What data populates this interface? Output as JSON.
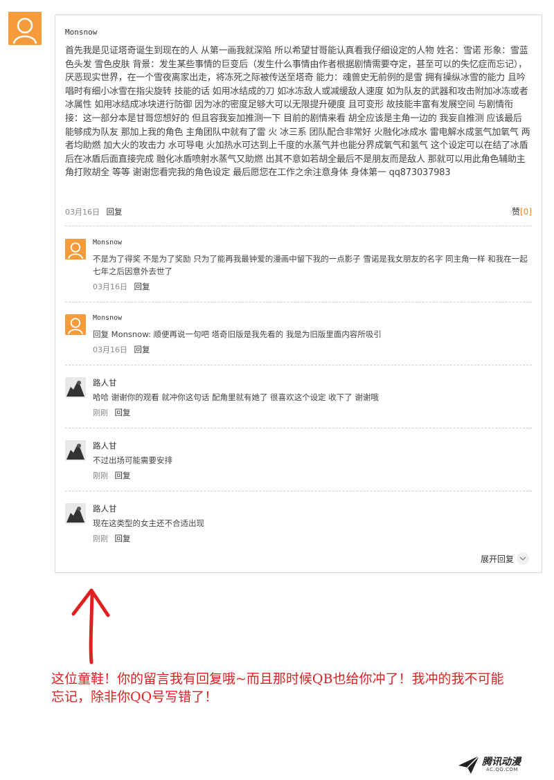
{
  "main_comment": {
    "username": "Monsnow",
    "text": "首先我是见证塔奇诞生到现在的人 从第一画我就深陷 所以希望甘哥能认真看我仔细设定的人物 姓名：雪诺 形象：雪蓝色头发 雪色皮肤 背景：发生某些事情的巨变后（发生什么事情由作者根据剧情需要夺定，甚至可以的失忆症而忘记），厌恶现实世界，在一个雪夜离家出走，将冻死之际被传送至塔奇 能力：魂兽史无前例的是雪 拥有操纵冰雪的能力 且吟唱时有细小冰雪在指尖旋转 技能的话 如用冰结成的刀 如冰冻敌人或减缓敌人速度 如为队友的武器和攻击附加冰冻或者冰属性 如用冰结成冰块进行防御 因为冰的密度足够大可以无限提升硬度 且可变形 故技能丰富有发展空间 与剧情衔接：这一部分本是甘哥您想好的 但且容我妄加推测一下 目前的剧情来看 胡全应该是主角一边的 我妄自推测 应该最后能够成为队友 那加上我的角色 主角团队中就有了雷 火 冰三系 团队配合非常好 火融化冰成水 雷电解水成氢气加氧气 两者均助燃 加大火的攻击力 水可导电 火加热水可达到上千度的水蒸气并也能分界成氧气和氢气 这个设定可以在结了冰盾后在冰盾后面直接完成 融化冰盾喷射水蒸气又助燃 出其不意如若胡全最后不是朋友而是敌人 那就可以用此角色辅助主角打败胡全 等等 谢谢您看完我的角色设定 最后愿您在工作之余注意身体 身体第一 qq873037983",
    "date": "03月16日",
    "reply_label": "回复",
    "like_label": "赞",
    "like_count": "[0]"
  },
  "replies": [
    {
      "username": "Monsnow",
      "text": "不是为了得奖 不是为了奖励 只为了能再我最钟爱的漫画中留下我的一点影子 雪诺是我女朋友的名字 同主角一样 和我在一起七年之后因意外去世了",
      "date": "03月16日",
      "reply_label": "回复"
    },
    {
      "username": "Monsnow",
      "text": "回复 Monsnow: 顺便再说一句吧 塔奇旧版是我先看的 我是为旧版里面内容所吸引",
      "date": "03月16日",
      "reply_label": "回复"
    },
    {
      "username": "路人甘",
      "text": "哈哈 谢谢你的观看 就冲你这句话 配角里就有她了 很喜欢这个设定 收下了 谢谢哦",
      "date": "刚刚",
      "reply_label": "回复"
    },
    {
      "username": "路人甘",
      "text": "不过出场可能需要安排",
      "date": "刚刚",
      "reply_label": "回复"
    },
    {
      "username": "路人甘",
      "text": "现在这类型的女主还不合适出现",
      "date": "刚刚",
      "reply_label": "回复"
    }
  ],
  "expand_label": "展开回复",
  "annotation": {
    "text": "这位童鞋！你的留言我有回复哦~而且那时候QB也给你冲了！我冲的我不可能忘记，除非你QQ号写错了！",
    "color": "#e02020"
  },
  "logo": {
    "brand": "腾讯动漫",
    "sub": "AC.QQ.COM"
  },
  "colors": {
    "avatar_orange": "#f59b3c",
    "like_count": "#f08b1e"
  }
}
